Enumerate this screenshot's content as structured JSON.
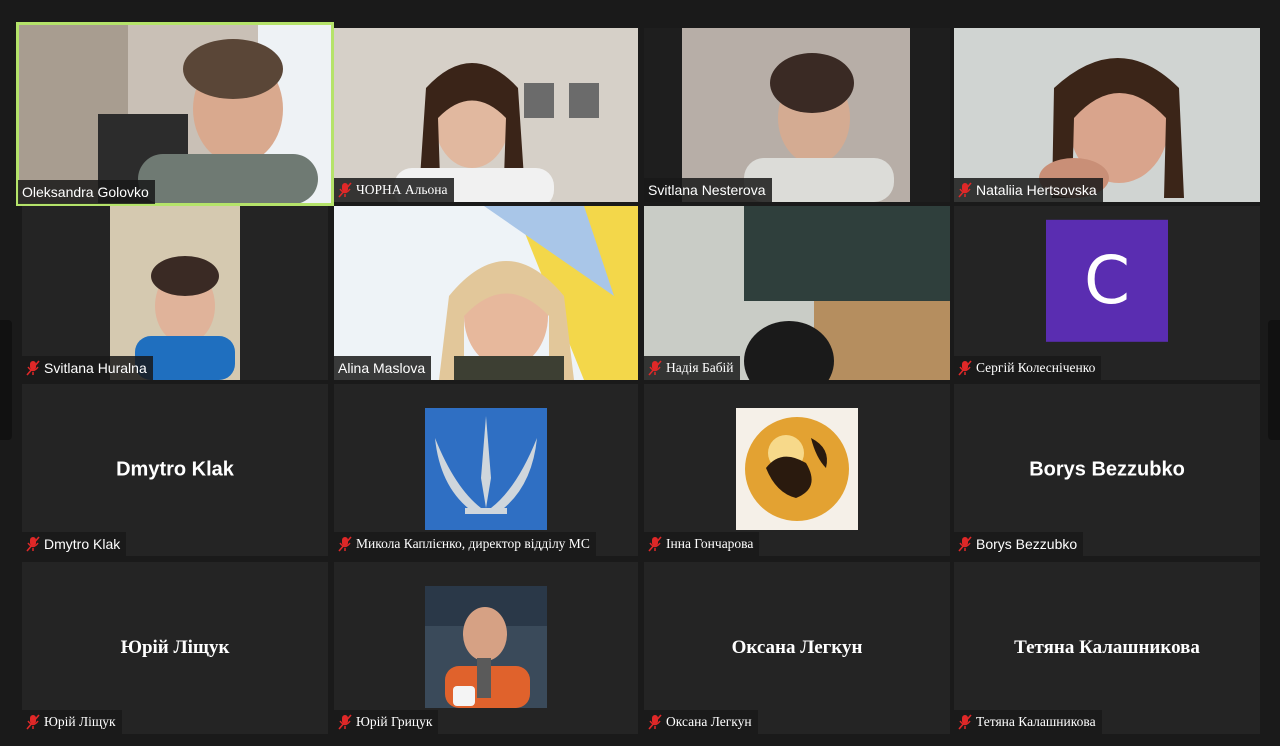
{
  "participants": [
    {
      "name": "Oleksandra Golovko",
      "muted": false
    },
    {
      "name": "ЧОРНА Альона",
      "muted": true
    },
    {
      "name": "Svitlana Nesterova",
      "muted": false
    },
    {
      "name": "Nataliia Hertsovska",
      "muted": true
    },
    {
      "name": "Svitlana Huralna",
      "muted": true
    },
    {
      "name": "Alina Maslova",
      "muted": false
    },
    {
      "name": "Надія Бабій",
      "muted": true
    },
    {
      "name": "Сергій Колесніченко",
      "muted": true
    },
    {
      "name": "Dmytro Klak",
      "muted": true
    },
    {
      "name": "Микола Каплієнко, директор відділу МС",
      "muted": true
    },
    {
      "name": "Інна Гончарова",
      "muted": true
    },
    {
      "name": "Borys Bezzubko",
      "muted": true
    },
    {
      "name": "Юрій Ліщук",
      "muted": true
    },
    {
      "name": "Юрій Грицук",
      "muted": true
    },
    {
      "name": "Оксана Легкун",
      "muted": true
    },
    {
      "name": "Тетяна Калашникова",
      "muted": true
    }
  ],
  "avatar_initial": "C",
  "colors": {
    "active_border": "#b5e36a",
    "mute": "#e02828",
    "avatar_bg": "#5a2db1"
  }
}
